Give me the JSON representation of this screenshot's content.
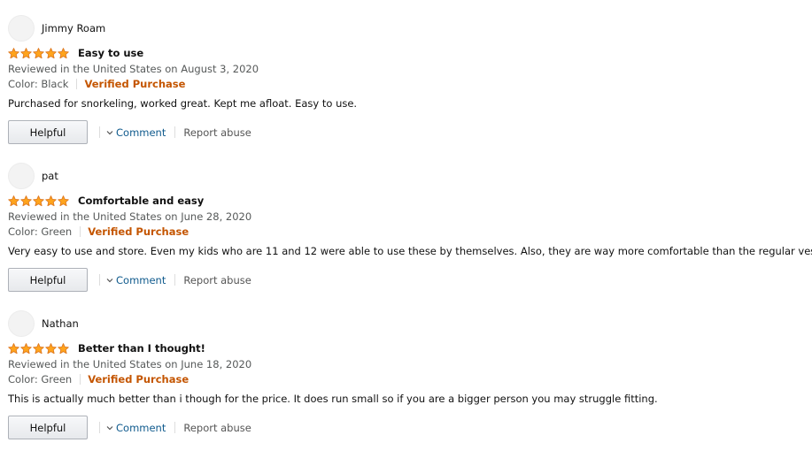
{
  "reviews": [
    {
      "author": "Jimmy Roam",
      "rating": 5,
      "title": "Easy to use",
      "date": "Reviewed in the United States on August 3, 2020",
      "variant": "Color: Black",
      "verified": "Verified Purchase",
      "body": "Purchased for snorkeling, worked great. Kept me afloat. Easy to use.",
      "helpful_label": "Helpful",
      "comment_label": "Comment",
      "report_label": "Report abuse"
    },
    {
      "author": "pat",
      "rating": 5,
      "title": "Comfortable and easy",
      "date": "Reviewed in the United States on June 28, 2020",
      "variant": "Color: Green",
      "verified": "Verified Purchase",
      "body": "Very easy to use and store. Even my kids who are 11 and 12 were able to use these by themselves. Also, they are way more comfortable than the regular vests.",
      "helpful_label": "Helpful",
      "comment_label": "Comment",
      "report_label": "Report abuse"
    },
    {
      "author": "Nathan",
      "rating": 5,
      "title": "Better than I thought!",
      "date": "Reviewed in the United States on June 18, 2020",
      "variant": "Color: Green",
      "verified": "Verified Purchase",
      "body": "This is actually much better than i though for the price. It does run small so if you are a bigger person you may struggle fitting.",
      "helpful_label": "Helpful",
      "comment_label": "Comment",
      "report_label": "Report abuse"
    }
  ],
  "icons": {
    "star": "star-icon",
    "chevron": "chevron-down-icon"
  },
  "colors": {
    "star_fill": "#ffa41c",
    "star_stroke": "#de7921",
    "verified": "#c45500",
    "link": "#0f5a8d",
    "muted": "#565959"
  }
}
